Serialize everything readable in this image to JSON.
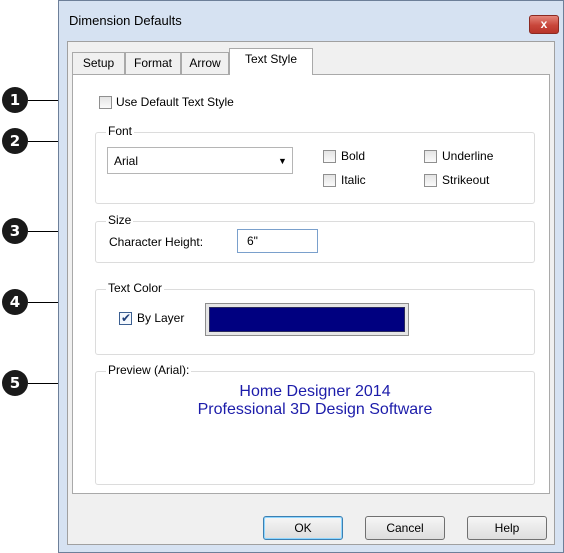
{
  "window": {
    "title": "Dimension Defaults",
    "close_glyph": "x"
  },
  "tabs": [
    {
      "label": "Setup",
      "active": false
    },
    {
      "label": "Format",
      "active": false
    },
    {
      "label": "Arrow",
      "active": false
    },
    {
      "label": "Text Style",
      "active": true
    }
  ],
  "use_default": {
    "label": "Use Default Text Style",
    "checked": false
  },
  "font": {
    "group_label": "Font",
    "selected": "Arial",
    "bold": {
      "label": "Bold",
      "checked": false
    },
    "italic": {
      "label": "Italic",
      "checked": false
    },
    "underline": {
      "label": "Underline",
      "checked": false
    },
    "strikeout": {
      "label": "Strikeout",
      "checked": false
    }
  },
  "size": {
    "group_label": "Size",
    "char_height_label": "Character Height:",
    "char_height_value": "6\""
  },
  "text_color": {
    "group_label": "Text Color",
    "by_layer_label": "By Layer",
    "by_layer_checked": true,
    "color": "#000080"
  },
  "preview": {
    "group_label": "Preview (Arial):",
    "line1": "Home Designer 2014",
    "line2": "Professional 3D Design Software"
  },
  "buttons": {
    "ok": "OK",
    "cancel": "Cancel",
    "help": "Help"
  },
  "callouts": [
    "1",
    "2",
    "3",
    "4",
    "5"
  ]
}
